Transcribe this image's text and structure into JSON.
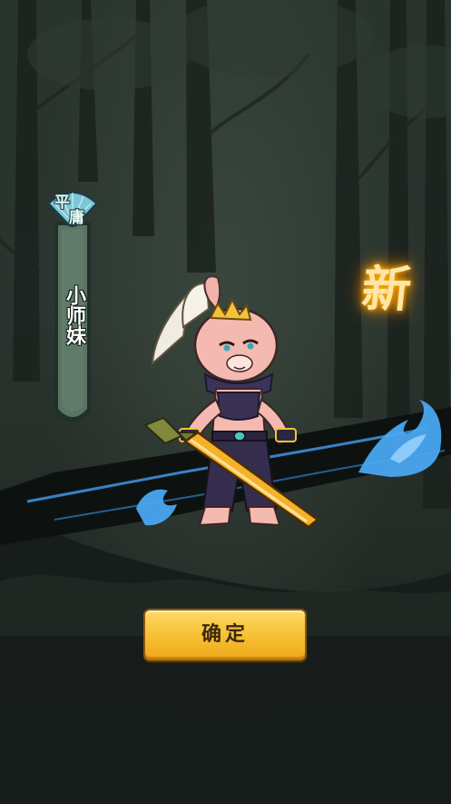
{
  "hero": {
    "rarity_char_1": "平",
    "rarity_char_2": "庸",
    "name": "小师妹"
  },
  "badge": {
    "label": "新"
  },
  "buttons": {
    "confirm_label": "确定"
  },
  "colors": {
    "banner": "#5b7363",
    "rarity_fan": "#7fc6d6",
    "new_glow": "#ffb300",
    "button": "#f6bf2f",
    "flame": "#4aa8f0"
  },
  "icons": [
    "fan-emblem-icon",
    "sword-icon",
    "blue-flame-icon"
  ]
}
